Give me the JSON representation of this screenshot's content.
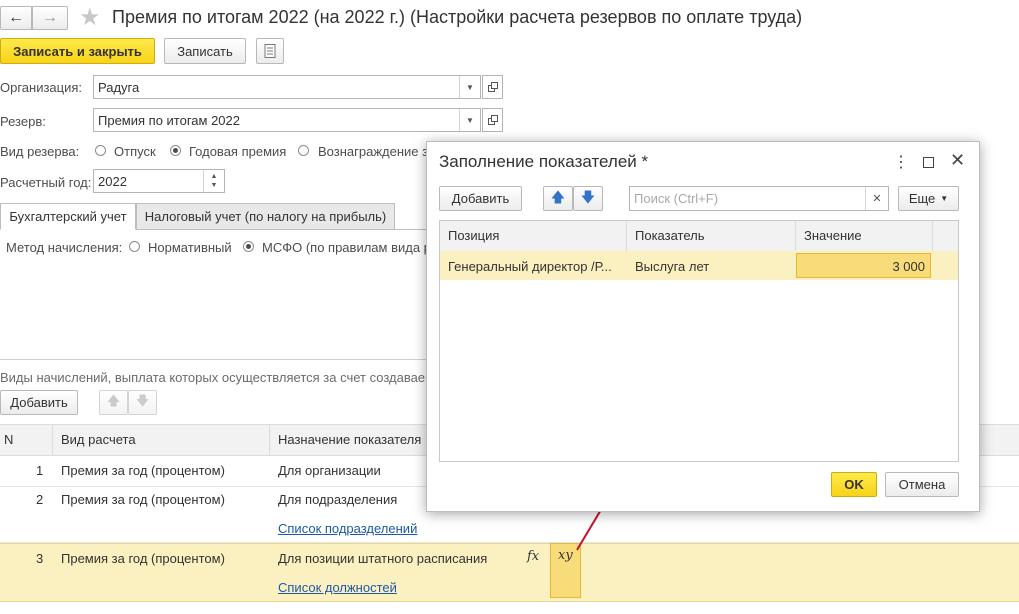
{
  "window": {
    "title": "Премия по итогам 2022 (на 2022 г.) (Настройки расчета резервов по оплате труда)"
  },
  "toolbar": {
    "save_close_label": "Записать и закрыть",
    "save_label": "Записать"
  },
  "form": {
    "org_label": "Организация:",
    "org_value": "Радуга",
    "reserve_label": "Резерв:",
    "reserve_value": "Премия по итогам 2022",
    "type_label": "Вид резерва:",
    "type_options": [
      "Отпуск",
      "Годовая премия",
      "Вознаграждение з"
    ],
    "type_selected": "Годовая премия",
    "year_label": "Расчетный год:",
    "year_value": "2022"
  },
  "tabs": {
    "accounting": "Бухгалтерский учет",
    "tax": "Налоговый учет (по налогу на прибыль)"
  },
  "method": {
    "label": "Метод начисления:",
    "option_normative": "Нормативный",
    "option_ifrs": "МСФО (по правилам вида р"
  },
  "accruals": {
    "caption": "Виды начислений, выплата которых осуществляется за счет создаваем",
    "add_label": "Добавить",
    "columns": [
      "N",
      "Вид расчета",
      "Назначение показателя"
    ],
    "rows": [
      {
        "n": "1",
        "kind": "Премия за год (процентом)",
        "purpose": "Для организации",
        "link": ""
      },
      {
        "n": "2",
        "kind": "Премия за год (процентом)",
        "purpose": "Для подразделения",
        "link": "Список подразделений"
      },
      {
        "n": "3",
        "kind": "Премия за год (процентом)",
        "purpose": "Для позиции штатного расписания",
        "link": "Список должностей"
      }
    ],
    "fx_label": "fx",
    "xy_label": "xy"
  },
  "dialog": {
    "title": "Заполнение показателей *",
    "add_label": "Добавить",
    "search_placeholder": "Поиск (Ctrl+F)",
    "more_label": "Еще",
    "columns": [
      "Позиция",
      "Показатель",
      "Значение"
    ],
    "rows": [
      {
        "position": "Генеральный директор  /Р...",
        "indicator": "Выслуга лет",
        "value": "3 000"
      }
    ],
    "ok_label": "OK",
    "cancel_label": "Отмена"
  },
  "colors": {
    "accent_yellow": "#f7d319",
    "selected_row": "#fbf0c0",
    "arrow_red": "#c8102e",
    "link_blue": "#1d5aa5"
  }
}
